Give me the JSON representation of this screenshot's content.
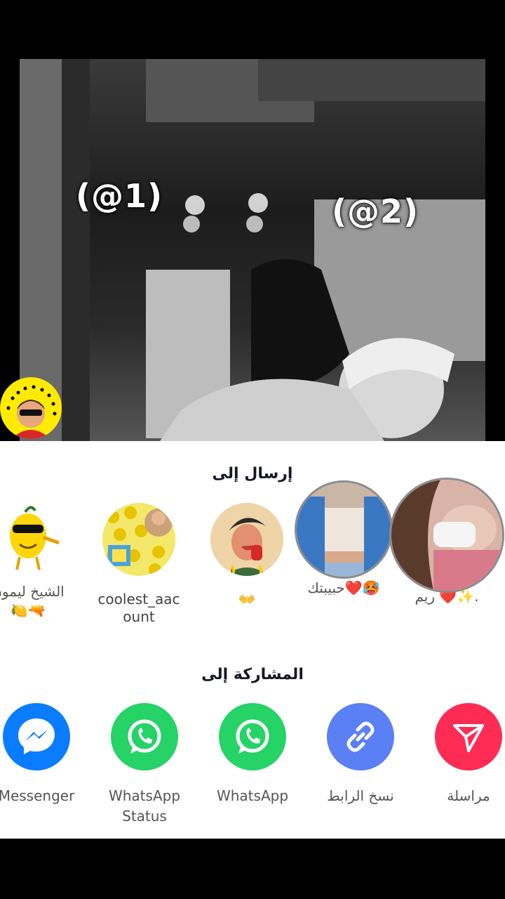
{
  "video": {
    "tag1": "(@1)",
    "tag2": "(@2)"
  },
  "send_to": {
    "title": "إرسال إلى",
    "contacts": [
      {
        "name": "الشيخ ليمون",
        "sub": "🍋🔫",
        "avatar": "lemon-sticker"
      },
      {
        "name": "coolest_aac",
        "sub": "ount",
        "avatar": "spongebob-collage"
      },
      {
        "name": "👐",
        "sub": "",
        "avatar": "boy-cartoon"
      },
      {
        "name": "حبيبتك❤️🥵",
        "sub": "",
        "avatar": "girl-photo-1"
      },
      {
        "name": "ريم ❤️✨.",
        "sub": "",
        "avatar": "girl-photo-2"
      }
    ]
  },
  "share_to": {
    "title": "المشاركة إلى",
    "apps": [
      {
        "label": "Messenger",
        "label2": "",
        "color": "#0a7cff",
        "icon": "messenger-icon"
      },
      {
        "label": "WhatsApp",
        "label2": "Status",
        "color": "#25d366",
        "icon": "whatsapp-icon"
      },
      {
        "label": "WhatsApp",
        "label2": "",
        "color": "#25d366",
        "icon": "whatsapp-icon"
      },
      {
        "label": "نسخ الرابط",
        "label2": "",
        "color": "#5b7ff5",
        "icon": "link-icon"
      },
      {
        "label": "مراسلة",
        "label2": "",
        "color": "#fe2c55",
        "icon": "send-icon"
      }
    ]
  }
}
